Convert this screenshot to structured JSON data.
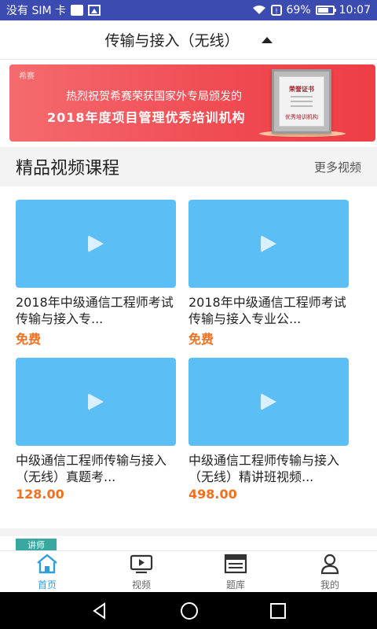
{
  "status_bar": {
    "carrier": "没有 SIM 卡",
    "battery": "69%",
    "time": "10:07"
  },
  "header": {
    "title": "传输与接入（无线）"
  },
  "banner": {
    "logo": "希赛",
    "line1": "热烈祝贺希赛荣获国家外专局颁发的",
    "line2": "2018年度项目管理优秀培训机构",
    "certificate_title": "荣誉证书",
    "certificate_sub": "优秀培训机构"
  },
  "section": {
    "title": "精品视频课程",
    "more": "更多视频"
  },
  "courses": [
    {
      "title": "2018年中级通信工程师考试传输与接入专...",
      "price": "免费"
    },
    {
      "title": "2018年中级通信工程师考试传输与接入专业公...",
      "price": "免费"
    },
    {
      "title": "中级通信工程师传输与接入（无线）真题考...",
      "price": "128.00"
    },
    {
      "title": "中级通信工程师传输与接入（无线）精讲班视频...",
      "price": "498.00"
    }
  ],
  "next_section_tag": "讲师",
  "bottom_nav": [
    {
      "label": "首页",
      "icon": "home-icon",
      "active": true
    },
    {
      "label": "视频",
      "icon": "video-icon",
      "active": false
    },
    {
      "label": "题库",
      "icon": "question-bank-icon",
      "active": false
    },
    {
      "label": "我的",
      "icon": "profile-icon",
      "active": false
    }
  ],
  "colors": {
    "status_bar": "#3b4bb0",
    "accent": "#2e9fd8",
    "price": "#f07020",
    "thumbnail": "#5bbef5",
    "banner": "#f04a52"
  }
}
